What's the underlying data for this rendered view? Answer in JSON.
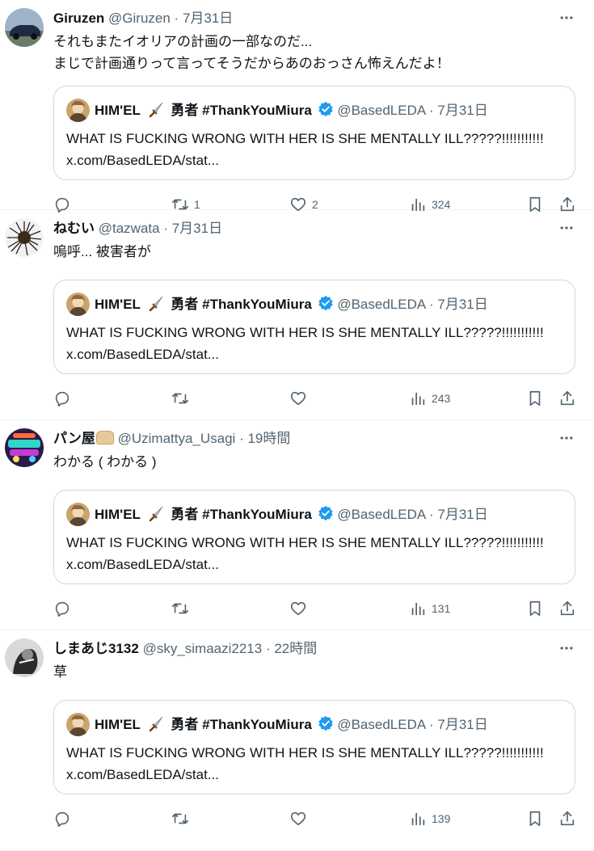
{
  "tweets": [
    {
      "name": "Giruzen",
      "handle": "@Giruzen",
      "sep": " · ",
      "time": "7月31日",
      "text": "それもまたイオリアの計画の一部なのだ...\nまじで計画通りって言ってそうだからあのおっさん怖えんだよ！",
      "reposts": "1",
      "likes": "2",
      "views": "324"
    },
    {
      "name": "ねむい",
      "handle": "@tazwata",
      "sep": " · ",
      "time": "7月31日",
      "text": "嗚呼... 被害者が",
      "reposts": "",
      "likes": "",
      "views": "243"
    },
    {
      "name": "パン屋",
      "handle": "@Uzimattya_Usagi",
      "sep": " · ",
      "time": "19時間",
      "text": "わかる ( わかる )",
      "reposts": "",
      "likes": "",
      "views": "131"
    },
    {
      "name": "しまあじ3132",
      "handle": "@sky_simaazi2213",
      "sep": " · ",
      "time": "22時間",
      "text": "草",
      "reposts": "",
      "likes": "",
      "views": "139"
    }
  ],
  "quote": {
    "name_a": "HIM'EL",
    "name_b": "勇者 #ThankYouMiura",
    "handle": "@BasedLEDA",
    "sep": " · ",
    "time": "7月31日",
    "text": "WHAT IS FUCKING WRONG WITH HER IS SHE MENTALLY ILL?????!!!!!!!!!!!\nx.com/BasedLEDA/stat..."
  },
  "colors": {
    "text": "#0f1419",
    "secondary": "#536471",
    "border": "#cfd9de",
    "verified": "#1d9bf0"
  },
  "icons": [
    "more-icon",
    "reply-icon",
    "repost-icon",
    "like-icon",
    "views-icon",
    "bookmark-icon",
    "share-icon",
    "verified-badge-icon",
    "dagger-icon",
    "bread-emoji-icon"
  ]
}
